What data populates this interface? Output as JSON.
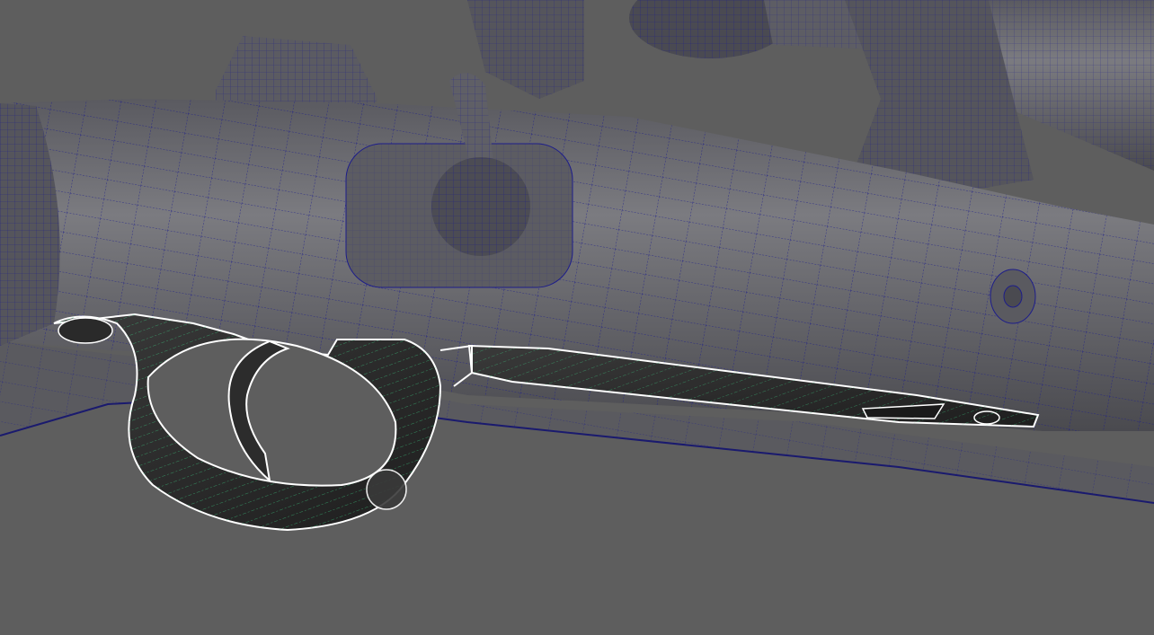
{
  "viewport": {
    "background_color": "#5e5e5e",
    "mesh_color": "#6a6a6e",
    "wireframe_color": "#1a1a8c",
    "selection_outline_color": "#ffffff",
    "selection_wire_color": "#3ddc8a",
    "selected_object": "trigger-guard-assembly"
  }
}
